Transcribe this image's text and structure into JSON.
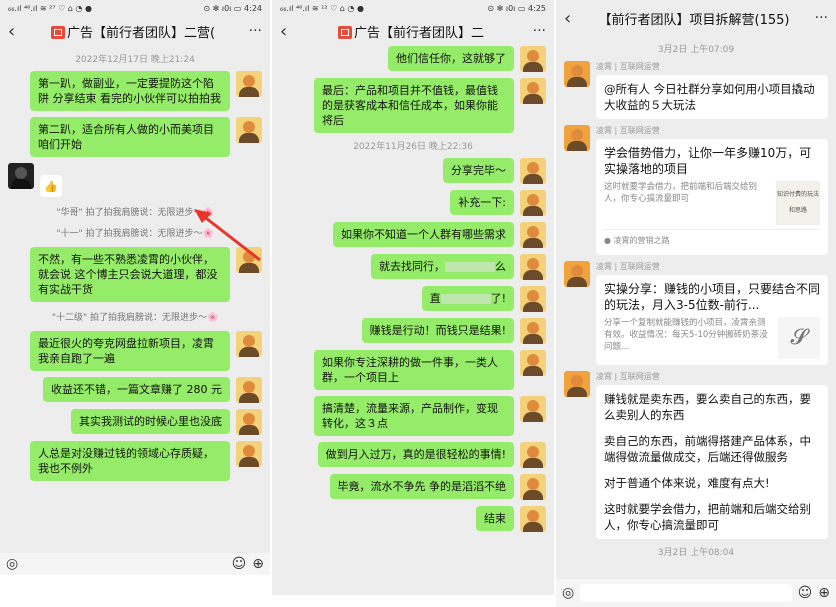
{
  "panel1": {
    "status": {
      "left": "₆₆.ıl ⁴⁶.ıl ≋ ²⁷ ♡ ⌂ ◔ ●",
      "right": "⊙ ✻ ı0ı ▭ 4:24"
    },
    "title": "广告【前行者团队】二营(",
    "time": "2022年12月17日 晚上21:24",
    "messages": [
      "第一趴，做副业，一定要提防这个陷阱 分享结束 看完的小伙伴可以拍拍我",
      "第二趴，适合所有人做的小而美项目 咱们开始"
    ],
    "sys1": "\"华哥\" 拍了拍我肩膀说：无限进步～🌸",
    "sys2": "\"十一\" 拍了拍我肩膀说：无限进步～🌸",
    "messages2": [
      "不然，有一些不熟悉凌霄的小伙伴，就会说 这个博主只会说大道理，都没有实战干货"
    ],
    "sys3": "\"十二级\" 拍了拍我肩膀说：无限进步～🌸",
    "messages3": [
      "最近很火的夸克网盘拉新项目，凌霄我亲自跑了一遍",
      "收益还不错，一篇文章赚了 280 元",
      "其实我测试的时候心里也没底",
      "人总是对没赚过钱的领域心存质疑，我也不例外"
    ]
  },
  "panel2": {
    "status": {
      "left": "₆₆.ıl ⁴⁶.ıl ≋ ¹² ♡ ⌂ ◔ ●",
      "right": "⊙ ✻ ı0ı ▭ 4:25"
    },
    "title": "广告【前行者团队】二",
    "m_top": "他们信任你，这就够了",
    "m_last": "最后：产品和项目并不值钱，最值钱的是获客成本和信任成本，如果你能将后",
    "time": "2022年11月26日 晚上22:36",
    "messages": [
      "分享完毕～",
      "补充一下:",
      "如果你不知道一个人群有哪些需求",
      "就去找同行，",
      "直",
      "赚钱是行动！而钱只是结果!",
      "如果你专注深耕的做一件事，一类人群，一个项目上",
      "搞清楚，流量来源，产品制作，变现转化，这３点",
      "做到月入过万，真的是很轻松的事情!",
      "毕竟，流水不争先 争的是滔滔不绝",
      "结束"
    ],
    "suffix_find": "么",
    "suffix_direct": "了!"
  },
  "panel3": {
    "title": "【前行者团队】项目拆解营(155)",
    "time1": "3月2日 上午07:09",
    "sender": "凌霄 | 互联网运营",
    "msg1": "@所有人  今日社群分享如何用小项目撬动大收益的５大玩法",
    "card1": {
      "title": "学会借势借力，让你一年多赚10万，可实操落地的项目",
      "desc": "这时就要学会借力，把前端和后端交给别人，你专心搞流量即可",
      "img": "知识付费的玩法和思路",
      "source": "凌霄的营销之路"
    },
    "card2": {
      "title": "实操分享：赚钱的小项目，只要结合不同的玩法，月入3-5位数-前行...",
      "desc": "分享一个复制就能赚钱的小项目，凌霄亲测有效。收益情况：每天5-10分钟搬砖奶茶没问题..."
    },
    "msg3": [
      "赚钱就是卖东西，要么卖自己的东西，要么卖别人的东西",
      "卖自己的东西，前端得搭建产品体系，中端得做流量做成交，后端还得做服务",
      "对于普通个体来说，难度有点大!",
      "这时就要学会借力，把前端和后端交给别人，你专心搞流量即可"
    ],
    "time2": "3月2日 上午08:04"
  },
  "icons": {
    "back": "‹",
    "more": "···",
    "voice": "◎",
    "emoji": "☺",
    "plus": "⊕",
    "link": "𝓢"
  }
}
